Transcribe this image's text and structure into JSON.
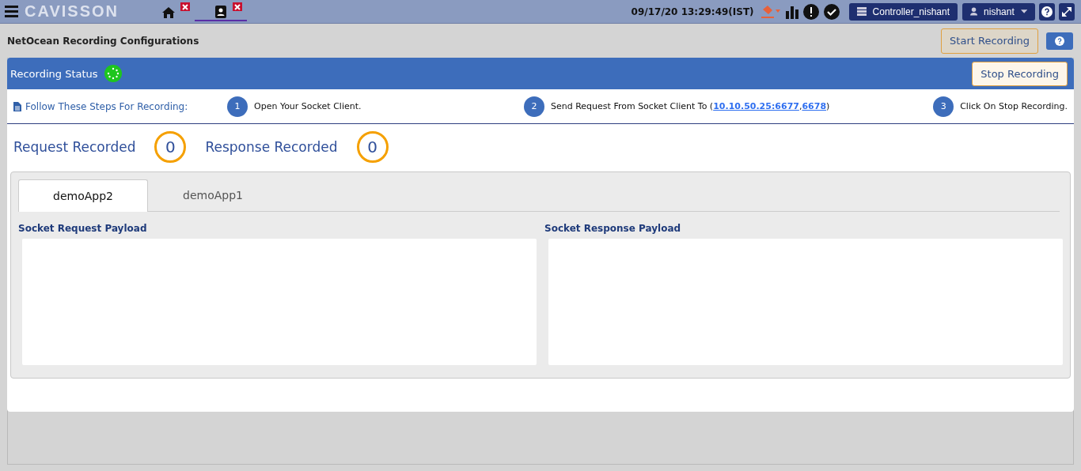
{
  "header": {
    "logo": "CAVISSON",
    "tabs": [
      {
        "kind": "home",
        "selected": false
      },
      {
        "kind": "contacts",
        "selected": true
      }
    ],
    "datetime": "09/17/20 13:29:49(IST)",
    "controller": "Controller_nishant",
    "user": "nishant"
  },
  "page": {
    "title": "NetOcean Recording Configurations",
    "start_button": "Start Recording"
  },
  "status_bar": {
    "label": "Recording Status",
    "stop_button": "Stop Recording"
  },
  "steps": {
    "heading": "Follow These Steps For Recording:",
    "items": [
      {
        "number": "1",
        "text": "Open Your Socket Client."
      },
      {
        "number": "2",
        "text": "Send Request From Socket Client To (",
        "links": [
          "10.10.50.25:6677",
          "6678"
        ],
        "link_separator": ",",
        "text_after": ")"
      },
      {
        "number": "3",
        "text": "Click On Stop Recording."
      }
    ]
  },
  "counters": [
    {
      "label": "Request Recorded",
      "value": "0"
    },
    {
      "label": "Response Recorded",
      "value": "0"
    }
  ],
  "app_tabs": [
    {
      "label": "demoApp2",
      "selected": true
    },
    {
      "label": "demoApp1",
      "selected": false
    }
  ],
  "payloads": [
    {
      "label": "Socket Request Payload"
    },
    {
      "label": "Socket Response Payload"
    }
  ]
}
